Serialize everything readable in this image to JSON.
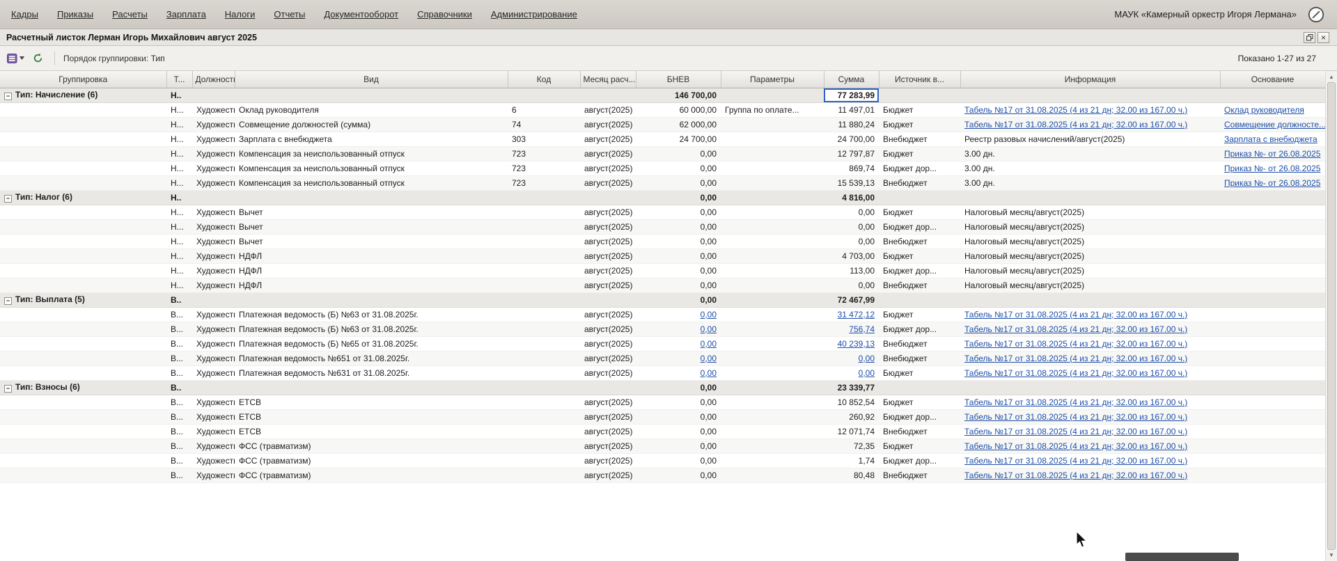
{
  "app": {
    "menu": [
      "Кадры",
      "Приказы",
      "Расчеты",
      "Зарплата",
      "Налоги",
      "Отчеты",
      "Документооборот",
      "Справочники",
      "Администрирование"
    ],
    "org": "МАУК «Камерный оркестр Игоря Лермана»"
  },
  "window": {
    "title": "Расчетный листок Лерман Игорь Михайлович август 2025"
  },
  "toolbar": {
    "grouping_label": "Порядок группировки:",
    "grouping_value": "Тип",
    "shown": "Показано 1-27 из 27"
  },
  "colors": {
    "link": "#1d4ea8",
    "selection_border": "#2e63c6",
    "group_row_bg": "#e9e8e5",
    "header_bg": "#e3e1dd",
    "menubar_bg": "#d4d1ca"
  },
  "table": {
    "columns": [
      "Группировка",
      "Т...",
      "Должность",
      "Вид",
      "Код",
      "Месяц расч...",
      "БНЕВ",
      "Параметры",
      "Сумма",
      "Источник в...",
      "Информация",
      "Основание"
    ],
    "groups": [
      {
        "label": "Тип: Начисление (6)",
        "t": "Н..",
        "bnev": "146 700,00",
        "sum": "77 283,99",
        "selected": true,
        "rows": [
          {
            "t": "Н...",
            "post": "Художестве...",
            "vid": "Оклад руководителя",
            "code": "6",
            "month": "август(2025)",
            "bnev": "60 000,00",
            "params": "Группа по оплате...",
            "sum": "11 497,01",
            "source": "Бюджет",
            "info": "Табель №17 от 31.08.2025 (4 из 21 дн; 32.00 из 167.00 ч.)",
            "info_link": true,
            "basis": "Оклад руководителя",
            "basis_link": true
          },
          {
            "t": "Н...",
            "post": "Художестве...",
            "vid": "Совмещение должностей (сумма)",
            "code": "74",
            "month": "август(2025)",
            "bnev": "62 000,00",
            "params": "",
            "sum": "11 880,24",
            "source": "Бюджет",
            "info": "Табель №17 от 31.08.2025 (4 из 21 дн; 32.00 из 167.00 ч.)",
            "info_link": true,
            "basis": "Совмещение должносте...",
            "basis_link": true
          },
          {
            "t": "Н...",
            "post": "Художестве...",
            "vid": "Зарплата с внебюджета",
            "code": "303",
            "month": "август(2025)",
            "bnev": "24 700,00",
            "params": "",
            "sum": "24 700,00",
            "source": "Внебюджет",
            "info": "Реестр разовых начислений/август(2025)",
            "info_link": false,
            "basis": "Зарплата с внебюджета",
            "basis_link": true
          },
          {
            "t": "Н...",
            "post": "Художестве...",
            "vid": "Компенсация за неиспользованный отпуск",
            "code": "723",
            "month": "август(2025)",
            "bnev": "0,00",
            "params": "",
            "sum": "12 797,87",
            "source": "Бюджет",
            "info": "3.00 дн.",
            "info_link": false,
            "basis": "Приказ №- от 26.08.2025",
            "basis_link": true
          },
          {
            "t": "Н...",
            "post": "Художестве...",
            "vid": "Компенсация за неиспользованный отпуск",
            "code": "723",
            "month": "август(2025)",
            "bnev": "0,00",
            "params": "",
            "sum": "869,74",
            "source": "Бюджет дор...",
            "info": "3.00 дн.",
            "info_link": false,
            "basis": "Приказ №- от 26.08.2025",
            "basis_link": true
          },
          {
            "t": "Н...",
            "post": "Художестве...",
            "vid": "Компенсация за неиспользованный отпуск",
            "code": "723",
            "month": "август(2025)",
            "bnev": "0,00",
            "params": "",
            "sum": "15 539,13",
            "source": "Внебюджет",
            "info": "3.00 дн.",
            "info_link": false,
            "basis": "Приказ №- от 26.08.2025",
            "basis_link": true
          }
        ]
      },
      {
        "label": "Тип: Налог (6)",
        "t": "Н..",
        "bnev": "0,00",
        "sum": "4 816,00",
        "selected": false,
        "rows": [
          {
            "t": "Н...",
            "post": "Художестве...",
            "vid": "Вычет",
            "code": "",
            "month": "август(2025)",
            "bnev": "0,00",
            "params": "",
            "sum": "0,00",
            "source": "Бюджет",
            "info": "Налоговый месяц/август(2025)",
            "info_link": false,
            "basis": ""
          },
          {
            "t": "Н...",
            "post": "Художестве...",
            "vid": "Вычет",
            "code": "",
            "month": "август(2025)",
            "bnev": "0,00",
            "params": "",
            "sum": "0,00",
            "source": "Бюджет дор...",
            "info": "Налоговый месяц/август(2025)",
            "info_link": false,
            "basis": ""
          },
          {
            "t": "Н...",
            "post": "Художестве...",
            "vid": "Вычет",
            "code": "",
            "month": "август(2025)",
            "bnev": "0,00",
            "params": "",
            "sum": "0,00",
            "source": "Внебюджет",
            "info": "Налоговый месяц/август(2025)",
            "info_link": false,
            "basis": ""
          },
          {
            "t": "Н...",
            "post": "Художестве...",
            "vid": "НДФЛ",
            "code": "",
            "month": "август(2025)",
            "bnev": "0,00",
            "params": "",
            "sum": "4 703,00",
            "source": "Бюджет",
            "info": "Налоговый месяц/август(2025)",
            "info_link": false,
            "basis": ""
          },
          {
            "t": "Н...",
            "post": "Художестве...",
            "vid": "НДФЛ",
            "code": "",
            "month": "август(2025)",
            "bnev": "0,00",
            "params": "",
            "sum": "113,00",
            "source": "Бюджет дор...",
            "info": "Налоговый месяц/август(2025)",
            "info_link": false,
            "basis": ""
          },
          {
            "t": "Н...",
            "post": "Художестве...",
            "vid": "НДФЛ",
            "code": "",
            "month": "август(2025)",
            "bnev": "0,00",
            "params": "",
            "sum": "0,00",
            "source": "Внебюджет",
            "info": "Налоговый месяц/август(2025)",
            "info_link": false,
            "basis": ""
          }
        ]
      },
      {
        "label": "Тип: Выплата (5)",
        "t": "В..",
        "bnev": "0,00",
        "sum": "72 467,99",
        "selected": false,
        "rows": [
          {
            "t": "В...",
            "post": "Художестве...",
            "vid": "Платежная ведомость (Б) №63 от 31.08.2025г.",
            "code": "",
            "month": "август(2025)",
            "bnev": "0,00",
            "bnev_link": true,
            "params": "",
            "sum": "31 472,12",
            "sum_link": true,
            "source": "Бюджет",
            "info": "Табель №17 от 31.08.2025 (4 из 21 дн; 32.00 из 167.00 ч.)",
            "info_link": true,
            "basis": ""
          },
          {
            "t": "В...",
            "post": "Художестве...",
            "vid": "Платежная ведомость (Б) №63 от 31.08.2025г.",
            "code": "",
            "month": "август(2025)",
            "bnev": "0,00",
            "bnev_link": true,
            "params": "",
            "sum": "756,74",
            "sum_link": true,
            "source": "Бюджет дор...",
            "info": "Табель №17 от 31.08.2025 (4 из 21 дн; 32.00 из 167.00 ч.)",
            "info_link": true,
            "basis": ""
          },
          {
            "t": "В...",
            "post": "Художестве...",
            "vid": "Платежная ведомость (Б) №65 от 31.08.2025г.",
            "code": "",
            "month": "август(2025)",
            "bnev": "0,00",
            "bnev_link": true,
            "params": "",
            "sum": "40 239,13",
            "sum_link": true,
            "source": "Внебюджет",
            "info": "Табель №17 от 31.08.2025 (4 из 21 дн; 32.00 из 167.00 ч.)",
            "info_link": true,
            "basis": ""
          },
          {
            "t": "В...",
            "post": "Художестве...",
            "vid": "Платежная ведомость №651 от 31.08.2025г.",
            "code": "",
            "month": "август(2025)",
            "bnev": "0,00",
            "bnev_link": true,
            "params": "",
            "sum": "0,00",
            "sum_link": true,
            "source": "Внебюджет",
            "info": "Табель №17 от 31.08.2025 (4 из 21 дн; 32.00 из 167.00 ч.)",
            "info_link": true,
            "basis": ""
          },
          {
            "t": "В...",
            "post": "Художестве...",
            "vid": "Платежная ведомость №631 от 31.08.2025г.",
            "code": "",
            "month": "август(2025)",
            "bnev": "0,00",
            "bnev_link": true,
            "params": "",
            "sum": "0,00",
            "sum_link": true,
            "source": "Бюджет",
            "info": "Табель №17 от 31.08.2025 (4 из 21 дн; 32.00 из 167.00 ч.)",
            "info_link": true,
            "basis": ""
          }
        ]
      },
      {
        "label": "Тип: Взносы (6)",
        "t": "В..",
        "bnev": "0,00",
        "sum": "23 339,77",
        "selected": false,
        "rows": [
          {
            "t": "В...",
            "post": "Художестве...",
            "vid": "ЕТСВ",
            "code": "",
            "month": "август(2025)",
            "bnev": "0,00",
            "params": "",
            "sum": "10 852,54",
            "source": "Бюджет",
            "info": "Табель №17 от 31.08.2025 (4 из 21 дн; 32.00 из 167.00 ч.)",
            "info_link": true,
            "basis": ""
          },
          {
            "t": "В...",
            "post": "Художестве...",
            "vid": "ЕТСВ",
            "code": "",
            "month": "август(2025)",
            "bnev": "0,00",
            "params": "",
            "sum": "260,92",
            "source": "Бюджет дор...",
            "info": "Табель №17 от 31.08.2025 (4 из 21 дн; 32.00 из 167.00 ч.)",
            "info_link": true,
            "basis": ""
          },
          {
            "t": "В...",
            "post": "Художестве...",
            "vid": "ЕТСВ",
            "code": "",
            "month": "август(2025)",
            "bnev": "0,00",
            "params": "",
            "sum": "12 071,74",
            "source": "Внебюджет",
            "info": "Табель №17 от 31.08.2025 (4 из 21 дн; 32.00 из 167.00 ч.)",
            "info_link": true,
            "basis": ""
          },
          {
            "t": "В...",
            "post": "Художестве...",
            "vid": "ФСС (травматизм)",
            "code": "",
            "month": "август(2025)",
            "bnev": "0,00",
            "params": "",
            "sum": "72,35",
            "source": "Бюджет",
            "info": "Табель №17 от 31.08.2025 (4 из 21 дн; 32.00 из 167.00 ч.)",
            "info_link": true,
            "basis": ""
          },
          {
            "t": "В...",
            "post": "Художестве...",
            "vid": "ФСС (травматизм)",
            "code": "",
            "month": "август(2025)",
            "bnev": "0,00",
            "params": "",
            "sum": "1,74",
            "source": "Бюджет дор...",
            "info": "Табель №17 от 31.08.2025 (4 из 21 дн; 32.00 из 167.00 ч.)",
            "info_link": true,
            "basis": ""
          },
          {
            "t": "В...",
            "post": "Художестве...",
            "vid": "ФСС (травматизм)",
            "code": "",
            "month": "август(2025)",
            "bnev": "0,00",
            "params": "",
            "sum": "80,48",
            "source": "Внебюджет",
            "info": "Табель №17 от 31.08.2025 (4 из 21 дн; 32.00 из 167.00 ч.)",
            "info_link": true,
            "basis": ""
          }
        ]
      }
    ]
  }
}
